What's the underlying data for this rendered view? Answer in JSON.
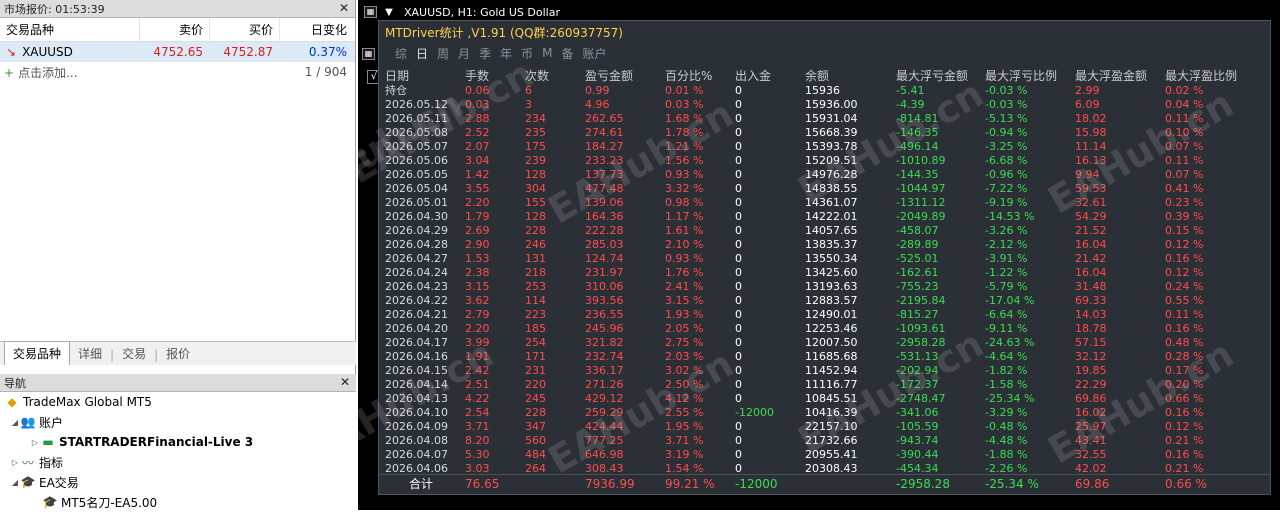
{
  "market_watch": {
    "title": "市场报价: 01:53:39",
    "headers": [
      "交易品种",
      "卖价",
      "买价",
      "日变化"
    ],
    "symbol": "XAUUSD",
    "bid": "4752.65",
    "ask": "4752.87",
    "change": "0.37%",
    "add_label": "点击添加...",
    "count": "1 / 904",
    "tabs": [
      "交易品种",
      "详细",
      "交易",
      "报价"
    ]
  },
  "navigator": {
    "title": "导航",
    "items": [
      {
        "label": "TradeMax Global MT5",
        "icon": "broker-icon",
        "indent": 0
      },
      {
        "label": "账户",
        "icon": "accounts-icon",
        "indent": 1
      },
      {
        "label": "STARTRADERFinancial-Live 3",
        "icon": "account-card-icon",
        "indent": 2,
        "bold": true
      },
      {
        "label": "指标",
        "icon": "indicator-icon",
        "indent": 1
      },
      {
        "label": "EA交易",
        "icon": "ea-icon",
        "indent": 1
      },
      {
        "label": "MT5名刀-EA5.00",
        "icon": "ea-icon",
        "indent": 2
      }
    ]
  },
  "chart": {
    "title": "XAUUSD, H1:  Gold US Dollar"
  },
  "stats": {
    "title": "MTDriver统计 ,V1.91 (QQ群:260937757)",
    "tabs": [
      "综",
      "日",
      "周",
      "月",
      "季",
      "年",
      "币",
      "M",
      "备",
      "账户"
    ],
    "active_tab": 1,
    "headers": [
      "日期",
      "手数",
      "次数",
      "盈亏金额",
      "百分比%",
      "出入金",
      "余额",
      "最大浮亏金额",
      "最大浮亏比例",
      "最大浮盈金额",
      "最大浮盈比例"
    ],
    "rows": [
      [
        "持仓",
        "0.06",
        "6",
        "0.99",
        "0.01 %",
        "0",
        "15936",
        "-5.41",
        "-0.03 %",
        "2.99",
        "0.02 %"
      ],
      [
        "2026.05.12",
        "0.03",
        "3",
        "4.96",
        "0.03 %",
        "0",
        "15936.00",
        "-4.39",
        "-0.03 %",
        "6.09",
        "0.04 %"
      ],
      [
        "2026.05.11",
        "2.88",
        "234",
        "262.65",
        "1.68 %",
        "0",
        "15931.04",
        "-814.81",
        "-5.13 %",
        "18.02",
        "0.11 %"
      ],
      [
        "2026.05.08",
        "2.52",
        "235",
        "274.61",
        "1.78 %",
        "0",
        "15668.39",
        "-146.35",
        "-0.94 %",
        "15.98",
        "0.10 %"
      ],
      [
        "2026.05.07",
        "2.07",
        "175",
        "184.27",
        "1.21 %",
        "0",
        "15393.78",
        "-496.14",
        "-3.25 %",
        "11.14",
        "0.07 %"
      ],
      [
        "2026.05.06",
        "3.04",
        "239",
        "233.23",
        "1.56 %",
        "0",
        "15209.51",
        "-1010.89",
        "-6.68 %",
        "16.13",
        "0.11 %"
      ],
      [
        "2026.05.05",
        "1.42",
        "128",
        "137.73",
        "0.93 %",
        "0",
        "14976.28",
        "-144.35",
        "-0.96 %",
        "9.94",
        "0.07 %"
      ],
      [
        "2026.05.04",
        "3.55",
        "304",
        "477.48",
        "3.32 %",
        "0",
        "14838.55",
        "-1044.97",
        "-7.22 %",
        "59.53",
        "0.41 %"
      ],
      [
        "2026.05.01",
        "2.20",
        "155",
        "139.06",
        "0.98 %",
        "0",
        "14361.07",
        "-1311.12",
        "-9.19 %",
        "32.61",
        "0.23 %"
      ],
      [
        "2026.04.30",
        "1.79",
        "128",
        "164.36",
        "1.17 %",
        "0",
        "14222.01",
        "-2049.89",
        "-14.53 %",
        "54.29",
        "0.39 %"
      ],
      [
        "2026.04.29",
        "2.69",
        "228",
        "222.28",
        "1.61 %",
        "0",
        "14057.65",
        "-458.07",
        "-3.26 %",
        "21.52",
        "0.15 %"
      ],
      [
        "2026.04.28",
        "2.90",
        "246",
        "285.03",
        "2.10 %",
        "0",
        "13835.37",
        "-289.89",
        "-2.12 %",
        "16.04",
        "0.12 %"
      ],
      [
        "2026.04.27",
        "1.53",
        "131",
        "124.74",
        "0.93 %",
        "0",
        "13550.34",
        "-525.01",
        "-3.91 %",
        "21.42",
        "0.16 %"
      ],
      [
        "2026.04.24",
        "2.38",
        "218",
        "231.97",
        "1.76 %",
        "0",
        "13425.60",
        "-162.61",
        "-1.22 %",
        "16.04",
        "0.12 %"
      ],
      [
        "2026.04.23",
        "3.15",
        "253",
        "310.06",
        "2.41 %",
        "0",
        "13193.63",
        "-755.23",
        "-5.79 %",
        "31.48",
        "0.24 %"
      ],
      [
        "2026.04.22",
        "3.62",
        "114",
        "393.56",
        "3.15 %",
        "0",
        "12883.57",
        "-2195.84",
        "-17.04 %",
        "69.33",
        "0.55 %"
      ],
      [
        "2026.04.21",
        "2.79",
        "223",
        "236.55",
        "1.93 %",
        "0",
        "12490.01",
        "-815.27",
        "-6.64 %",
        "14.03",
        "0.11 %"
      ],
      [
        "2026.04.20",
        "2.20",
        "185",
        "245.96",
        "2.05 %",
        "0",
        "12253.46",
        "-1093.61",
        "-9.11 %",
        "18.78",
        "0.16 %"
      ],
      [
        "2026.04.17",
        "3.99",
        "254",
        "321.82",
        "2.75 %",
        "0",
        "12007.50",
        "-2958.28",
        "-24.63 %",
        "57.15",
        "0.48 %"
      ],
      [
        "2026.04.16",
        "1.91",
        "171",
        "232.74",
        "2.03 %",
        "0",
        "11685.68",
        "-531.13",
        "-4.64 %",
        "32.12",
        "0.28 %"
      ],
      [
        "2026.04.15",
        "2.42",
        "231",
        "336.17",
        "3.02 %",
        "0",
        "11452.94",
        "-202.94",
        "-1.82 %",
        "19.85",
        "0.17 %"
      ],
      [
        "2026.04.14",
        "2.51",
        "220",
        "271.26",
        "2.50 %",
        "0",
        "11116.77",
        "-172.37",
        "-1.58 %",
        "22.29",
        "0.20 %"
      ],
      [
        "2026.04.13",
        "4.22",
        "245",
        "429.12",
        "4.12 %",
        "0",
        "10845.51",
        "-2748.47",
        "-25.34 %",
        "69.86",
        "0.66 %"
      ],
      [
        "2026.04.10",
        "2.54",
        "228",
        "259.29",
        "2.55 %",
        "-12000",
        "10416.39",
        "-341.06",
        "-3.29 %",
        "16.02",
        "0.16 %"
      ],
      [
        "2026.04.09",
        "3.71",
        "347",
        "424.44",
        "1.95 %",
        "0",
        "22157.10",
        "-105.59",
        "-0.48 %",
        "25.97",
        "0.12 %"
      ],
      [
        "2026.04.08",
        "8.20",
        "560",
        "777.25",
        "3.71 %",
        "0",
        "21732.66",
        "-943.74",
        "-4.48 %",
        "43.41",
        "0.21 %"
      ],
      [
        "2026.04.07",
        "5.30",
        "484",
        "646.98",
        "3.19 %",
        "0",
        "20955.41",
        "-390.44",
        "-1.88 %",
        "32.55",
        "0.16 %"
      ],
      [
        "2026.04.06",
        "3.03",
        "264",
        "308.43",
        "1.54 %",
        "0",
        "20308.43",
        "-454.34",
        "-2.26 %",
        "42.02",
        "0.21 %"
      ]
    ],
    "total": [
      "合计",
      "76.65",
      "",
      "7936.99",
      "99.21 %",
      "-12000",
      "",
      "-2958.28",
      "-25.34 %",
      "69.86",
      "0.66 %"
    ]
  },
  "watermark": "EAHub.cn"
}
